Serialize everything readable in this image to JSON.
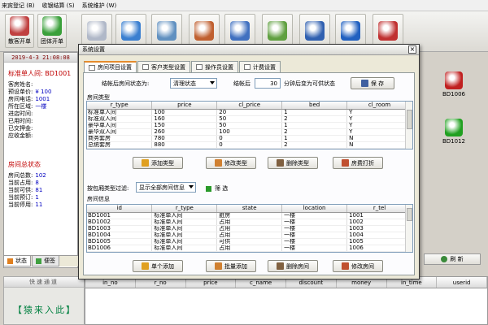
{
  "menu": [
    "来宾登记 (B)",
    "收银结算 (S)",
    "系统维护 (W)"
  ],
  "toolbar": {
    "buttons": [
      {
        "label": "散客开单",
        "icon": "guest-icon",
        "color": "#c04040"
      },
      {
        "label": "团体开单",
        "icon": "group-icon",
        "color": "#3aa03a"
      },
      {
        "label": "",
        "icon": "robot-icon",
        "color": "#b0b8c8"
      },
      {
        "label": "",
        "icon": "compass-icon",
        "color": "#3a7fd0"
      },
      {
        "label": "",
        "icon": "search-folder-icon",
        "color": "#6090c0"
      },
      {
        "label": "",
        "icon": "staff-icon",
        "color": "#c06030"
      },
      {
        "label": "",
        "icon": "users-icon",
        "color": "#4070c0"
      },
      {
        "label": "",
        "icon": "settings-icon",
        "color": "#60a040"
      },
      {
        "label": "",
        "icon": "tools-icon",
        "color": "#3060b0"
      },
      {
        "label": "",
        "icon": "phone-icon",
        "color": "#2060c0"
      },
      {
        "label": "",
        "icon": "exit-icon",
        "color": "#c03030"
      }
    ]
  },
  "left": {
    "clock": "2019-4-3  21:08:08",
    "room_title": "标准单人间:  BD1001",
    "info": [
      {
        "label": "客房姓名:",
        "value": ""
      },
      {
        "label": "预设单价:",
        "value": "¥ 100"
      },
      {
        "label": "房间电话:",
        "value": "1001"
      },
      {
        "label": "所在区域:",
        "value": "一楼"
      },
      {
        "label": "进店时间:",
        "value": ""
      },
      {
        "label": "已用时间:",
        "value": ""
      },
      {
        "label": "已交押金:",
        "value": ""
      },
      {
        "label": "应收金额:",
        "value": ""
      }
    ],
    "status_title": "房间总状态",
    "status": [
      {
        "label": "房间总数:",
        "value": "102"
      },
      {
        "label": "当前占用:",
        "value": "8"
      },
      {
        "label": "当前可供:",
        "value": "81"
      },
      {
        "label": "当前预订:",
        "value": "1"
      },
      {
        "label": "当前停用:",
        "value": "11"
      }
    ],
    "tabs": [
      "状态",
      "便签"
    ]
  },
  "right": {
    "cards": [
      {
        "id": "BD1006",
        "icon": "occupied-room-icon",
        "color": "#c02020"
      },
      {
        "id": "BD1012",
        "icon": "available-room-icon",
        "color": "#20a020"
      }
    ],
    "refresh_label": "刷 新"
  },
  "quick": {
    "title": "快速通道",
    "brand": "【猿来入此】"
  },
  "bottom_grid": {
    "columns": [
      "in_no",
      "r_no",
      "price",
      "c_name",
      "discount",
      "money",
      "in_time",
      "userid"
    ]
  },
  "dialog": {
    "title": "系统设置",
    "close": "×",
    "tabs": [
      "房间项目设置",
      "客户类型设置",
      "操作员设置",
      "计费设置"
    ],
    "active_tab": 0,
    "status_label": "结帐后房间状态为:",
    "status_value": "清理状态",
    "after_label": "结帐后",
    "minutes": "30",
    "minutes_label": "分钟后变为可供状态",
    "save_label": "保 存",
    "room_type_section": "房间类型",
    "room_types": {
      "columns": [
        "r_type",
        "price",
        "cl_price",
        "bed",
        "cl_room"
      ],
      "rows": [
        [
          "标准单人间",
          "100",
          "20",
          "1",
          "Y"
        ],
        [
          "标准双人间",
          "160",
          "50",
          "2",
          "Y"
        ],
        [
          "豪华单人间",
          "150",
          "50",
          "1",
          "Y"
        ],
        [
          "豪华双人间",
          "260",
          "100",
          "2",
          "Y"
        ],
        [
          "商务套房",
          "780",
          "0",
          "1",
          "N"
        ],
        [
          "总统套房",
          "880",
          "0",
          "2",
          "N"
        ]
      ]
    },
    "type_buttons": [
      "添加类型",
      "修改类型",
      "删除类型",
      "房费打折"
    ],
    "filter_label": "按包厢类型过滤:",
    "filter_value": "显示全部房间信息",
    "filter_button": "筛 选",
    "room_info_section": "房间信息",
    "rooms": {
      "columns": [
        "id",
        "r_type",
        "state",
        "location",
        "r_tel"
      ],
      "rows": [
        [
          "BD1001",
          "标准单人间",
          "脏房",
          "一楼",
          "1001"
        ],
        [
          "BD1002",
          "标准单人间",
          "占用",
          "一楼",
          "1002"
        ],
        [
          "BD1003",
          "标准单人间",
          "占用",
          "一楼",
          "1003"
        ],
        [
          "BD1004",
          "标准单人间",
          "占用",
          "一楼",
          "1004"
        ],
        [
          "BD1005",
          "标准单人间",
          "可供",
          "一楼",
          "1005"
        ],
        [
          "BD1006",
          "标准单人间",
          "占用",
          "一楼",
          "1006"
        ]
      ]
    },
    "room_buttons": [
      "单个添加",
      "批量添加",
      "删除房间",
      "修改房间"
    ]
  }
}
